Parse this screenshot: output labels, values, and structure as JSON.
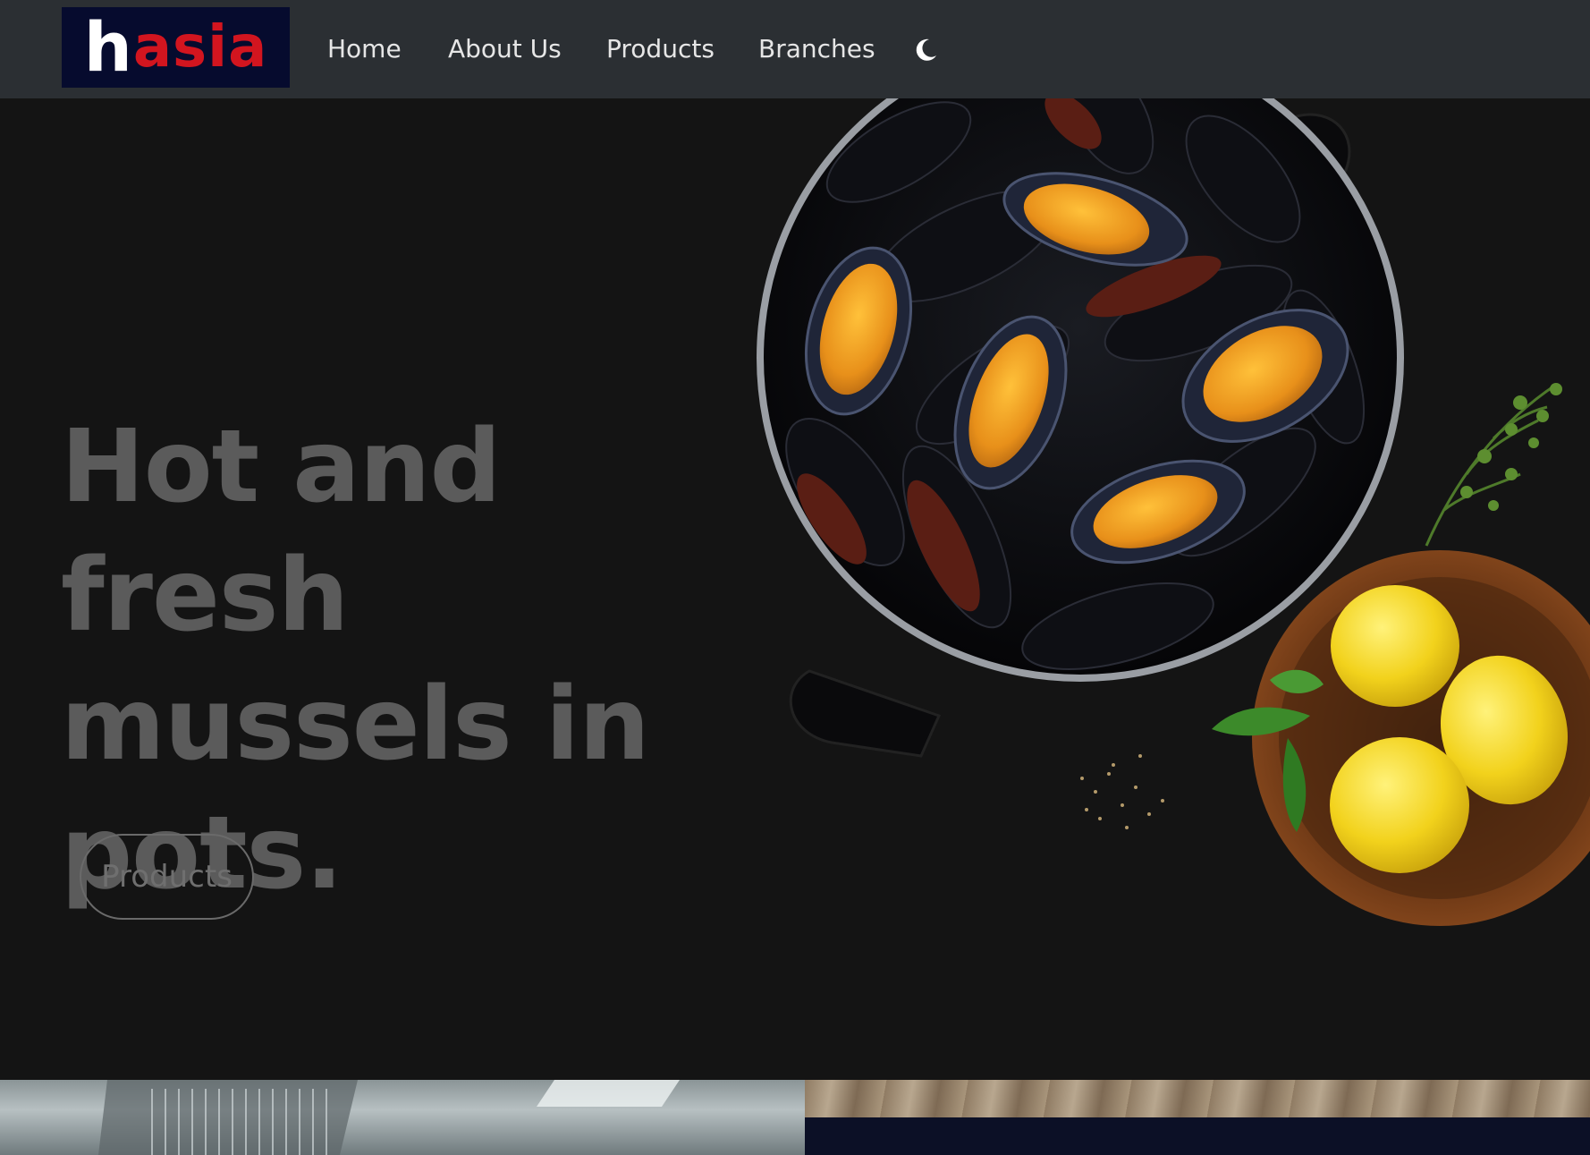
{
  "brand": {
    "logo_first_letter": "h",
    "logo_rest": "asia",
    "logo_bg": "#060b2e",
    "logo_accent": "#d2151f"
  },
  "nav": {
    "items": [
      {
        "label": "Home"
      },
      {
        "label": "About Us"
      },
      {
        "label": "Products"
      },
      {
        "label": "Branches"
      }
    ],
    "theme_toggle_icon": "moon-icon"
  },
  "hero": {
    "headline": "Hot and fresh mussels in pots.",
    "cta_label": "Products",
    "image_subject": "pot-of-mussels-with-lemons-and-herbs"
  },
  "colors": {
    "navbar_bg": "#2b2f33",
    "page_bg": "#141414",
    "headline": "#5b5b5b"
  }
}
